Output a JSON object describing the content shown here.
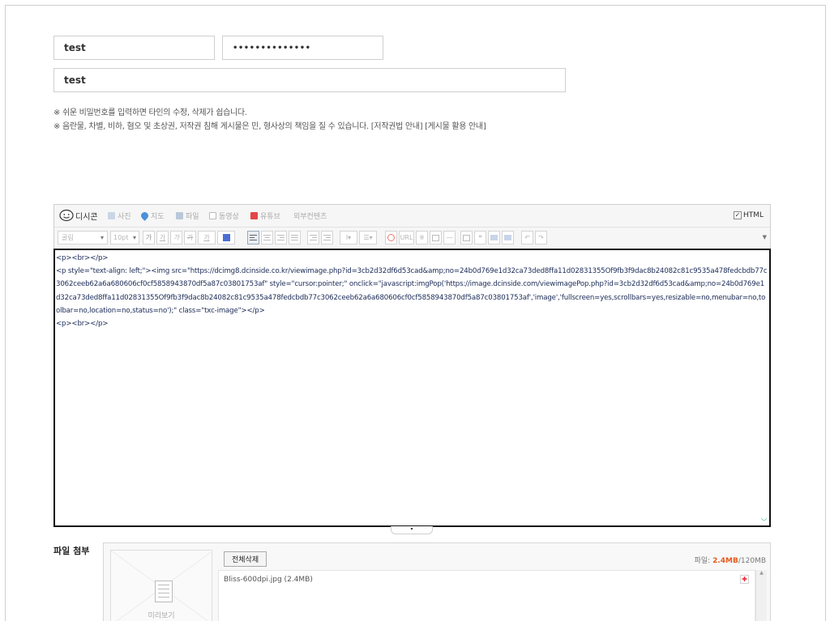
{
  "form": {
    "nickname_value": "test",
    "password_value": "••••••••••••••",
    "title_value": "test"
  },
  "notices": [
    "※ 쉬운 비밀번호를 입력하면 타인의 수정, 삭제가 쉽습니다.",
    "※ 음란물, 차별, 비하, 혐오 및 초상권, 저작권 침해 게시물은 민, 형사상의 책임을 질 수 있습니다. [저작권법 안내] [게시물 활용 안내]"
  ],
  "toolbar1": {
    "dcicon": "디시콘",
    "photo": "사진",
    "map": "지도",
    "file": "파일",
    "video": "동영상",
    "youtube": "유튜브",
    "external": "외부컨텐츠",
    "html_label": "HTML"
  },
  "toolbar2": {
    "font": "굴림",
    "size": "10pt",
    "bold": "가",
    "underline": "가",
    "italic": "가",
    "strike": "가",
    "fontcolor": "가",
    "url": "URL"
  },
  "editor": {
    "code": "<p><br></p>\n<p style=\"text-align: left;\"><img src=\"https://dcimg8.dcinside.co.kr/viewimage.php?id=3cb2d32df6d53cad&amp;no=24b0d769e1d32ca73ded8ffa11d02831355Of9fb3f9dac8b24082c81c9535a478fedcbdb77c3062ceeb62a6a680606cf0cf5858943870df5a87c03801753af\" style=\"cursor:pointer;\" onclick=\"javascript:imgPop('https://image.dcinside.com/viewimagePop.php?id=3cb2d32df6d53cad&amp;no=24b0d769e1d32ca73ded8ffa11d02831355Of9fb3f9dac8b24082c81c9535a478fedcbdb77c3062ceeb62a6a680606cf0cf5858943870df5a87c03801753af','image','fullscreen=yes,scrollbars=yes,resizable=no,menubar=no,toolbar=no,location=no,status=no');\" class=\"txc-image\"></p>\n<p><br></p>"
  },
  "attach": {
    "label": "파일 첨부",
    "preview_label": "미리보기",
    "delete_all": "전체삭제",
    "quota_prefix": "파일: ",
    "quota_used": "2.4MB",
    "quota_total": "/120MB",
    "files": [
      "Bliss-600dpi.jpg (2.4MB)"
    ]
  },
  "colors": {
    "accent": "#e85a1c",
    "youtube": "#e44646",
    "map": "#4a90d9"
  }
}
